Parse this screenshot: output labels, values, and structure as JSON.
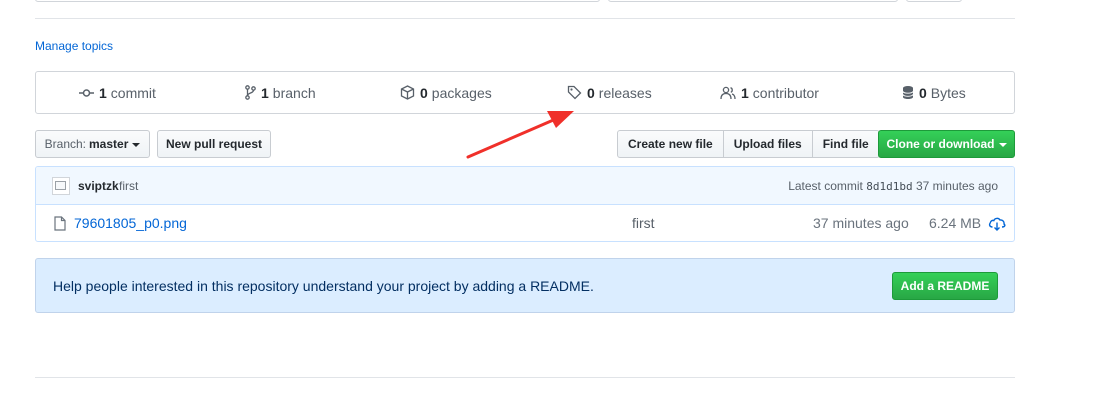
{
  "topics": {
    "manage_label": "Manage topics"
  },
  "summary": {
    "commits": {
      "count": "1",
      "label": "commit",
      "icon": "commit-icon"
    },
    "branches": {
      "count": "1",
      "label": "branch",
      "icon": "branch-icon"
    },
    "packages": {
      "count": "0",
      "label": "packages",
      "icon": "package-icon"
    },
    "releases": {
      "count": "0",
      "label": "releases",
      "icon": "tag-icon"
    },
    "contributors": {
      "count": "1",
      "label": "contributor",
      "icon": "people-icon"
    },
    "size": {
      "count": "0",
      "label": "Bytes",
      "icon": "database-icon"
    }
  },
  "toolbar": {
    "branch_prefix": "Branch:",
    "branch_name": "master",
    "new_pull_request": "New pull request",
    "create_new_file": "Create new file",
    "upload_files": "Upload files",
    "find_file": "Find file",
    "clone_or_download": "Clone or download"
  },
  "latest_commit": {
    "author": "sviptzk",
    "message": "first",
    "label": "Latest commit",
    "sha": "8d1d1bd",
    "age": "37 minutes ago"
  },
  "files": [
    {
      "name": "79601805_p0.png",
      "message": "first",
      "age": "37 minutes ago",
      "size": "6.24 MB",
      "icon": "file-icon"
    }
  ],
  "readme_prompt": {
    "text": "Help people interested in this repository understand your project by adding a README.",
    "button": "Add a README"
  },
  "colors": {
    "link": "#0366d6",
    "green_button": "#28a745",
    "readme_bg": "#dbedff",
    "annotation_arrow": "#f0302a"
  }
}
